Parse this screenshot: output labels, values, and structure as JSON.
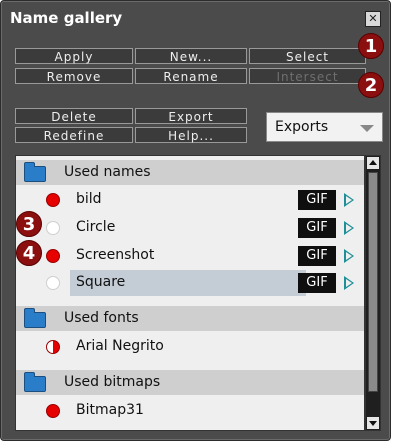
{
  "window": {
    "title": "Name gallery",
    "close_icon": "close-icon"
  },
  "buttons_row1": [
    "Apply",
    "New...",
    "Select"
  ],
  "buttons_row2": [
    "Remove",
    "Rename",
    "Intersect"
  ],
  "buttons_row3": [
    "Delete",
    "Export"
  ],
  "buttons_row4": [
    "Redefine",
    "Help..."
  ],
  "dropdown": {
    "selected": "Exports"
  },
  "badges": [
    "1",
    "2",
    "3",
    "4"
  ],
  "sections": [
    {
      "label": "Used names"
    },
    {
      "label": "Used fonts"
    },
    {
      "label": "Used bitmaps"
    }
  ],
  "names": [
    {
      "name": "bild",
      "export": "GIF"
    },
    {
      "name": "Circle",
      "export": "GIF"
    },
    {
      "name": "Screenshot",
      "export": "GIF"
    },
    {
      "name": "Square",
      "export": "GIF"
    }
  ],
  "fonts": [
    {
      "name": "Arial Negrito"
    }
  ],
  "bitmaps": [
    {
      "name": "Bitmap31"
    }
  ],
  "colors": {
    "panel": "#4b4b4b",
    "badge": "#8b0f0f",
    "list_bg": "#efefef",
    "selected_row": "#c4ccd6",
    "red_dot": "#e60000"
  }
}
